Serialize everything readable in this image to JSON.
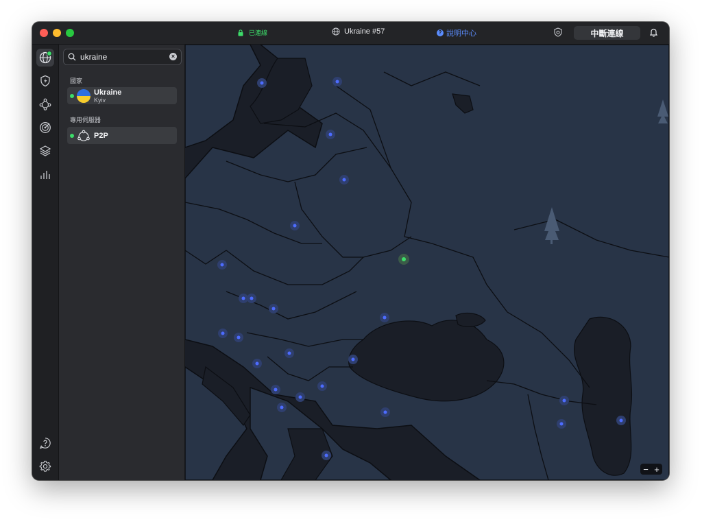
{
  "titlebar": {
    "status_text": "已連線",
    "server_name": "Ukraine #57",
    "help_text": "說明中心",
    "help_glyph": "?",
    "disconnect_label": "中斷連線"
  },
  "rail": {
    "items": [
      "globe-icon",
      "shield-bolt-icon",
      "meshnet-icon",
      "target-icon",
      "layers-icon",
      "stats-icon"
    ],
    "bottom": [
      "help-icon",
      "gear-icon"
    ]
  },
  "search": {
    "value": "ukraine",
    "clear_glyph": "×"
  },
  "panel": {
    "country_header": "國家",
    "country": {
      "name": "Ukraine",
      "city": "Kyiv"
    },
    "specialty_header": "專用伺服器",
    "specialty": {
      "name": "P2P"
    }
  },
  "zoom": {
    "minus": "−",
    "plus": "+"
  },
  "colors": {
    "connected": "#3ddc6a",
    "accent": "#5b8dff",
    "land": "#283447",
    "water": "#1a1e27",
    "server_pin": "#4d6cff"
  }
}
